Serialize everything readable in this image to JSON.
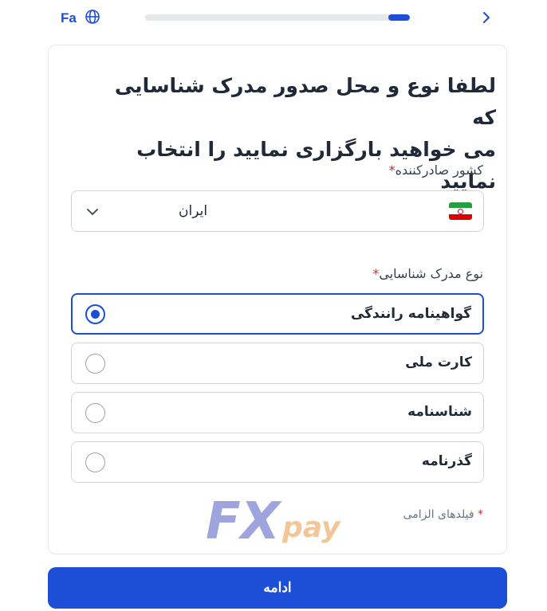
{
  "topbar": {
    "language_label": "Fa",
    "globe_icon": "globe-icon",
    "back_icon": "chevron-right-icon",
    "progress": 0.08,
    "accent_color": "#1d4ed8"
  },
  "form": {
    "title_line1": "لطفا نوع و محل صدور مدرک شناسایی که",
    "title_line2": "می خواهید بارگزاری نمایید را انتخاب نمایید",
    "country_label": "کشور صادرکننده",
    "required_mark": "*",
    "country_value": "ایران",
    "country_flag": "iran-flag-icon",
    "document_type_label": "نوع مدرک شناسایی",
    "document_options": [
      {
        "label": "گواهینامه رانندگی",
        "selected": true
      },
      {
        "label": "کارت ملی",
        "selected": false
      },
      {
        "label": "شناسنامه",
        "selected": false
      },
      {
        "label": "گذرنامه",
        "selected": false
      }
    ],
    "required_note_mark": "*",
    "required_note": "فیلدهای الزامی"
  },
  "logo": {
    "brand_name": "FXpay"
  },
  "continue_button": {
    "label": "ادامه"
  }
}
